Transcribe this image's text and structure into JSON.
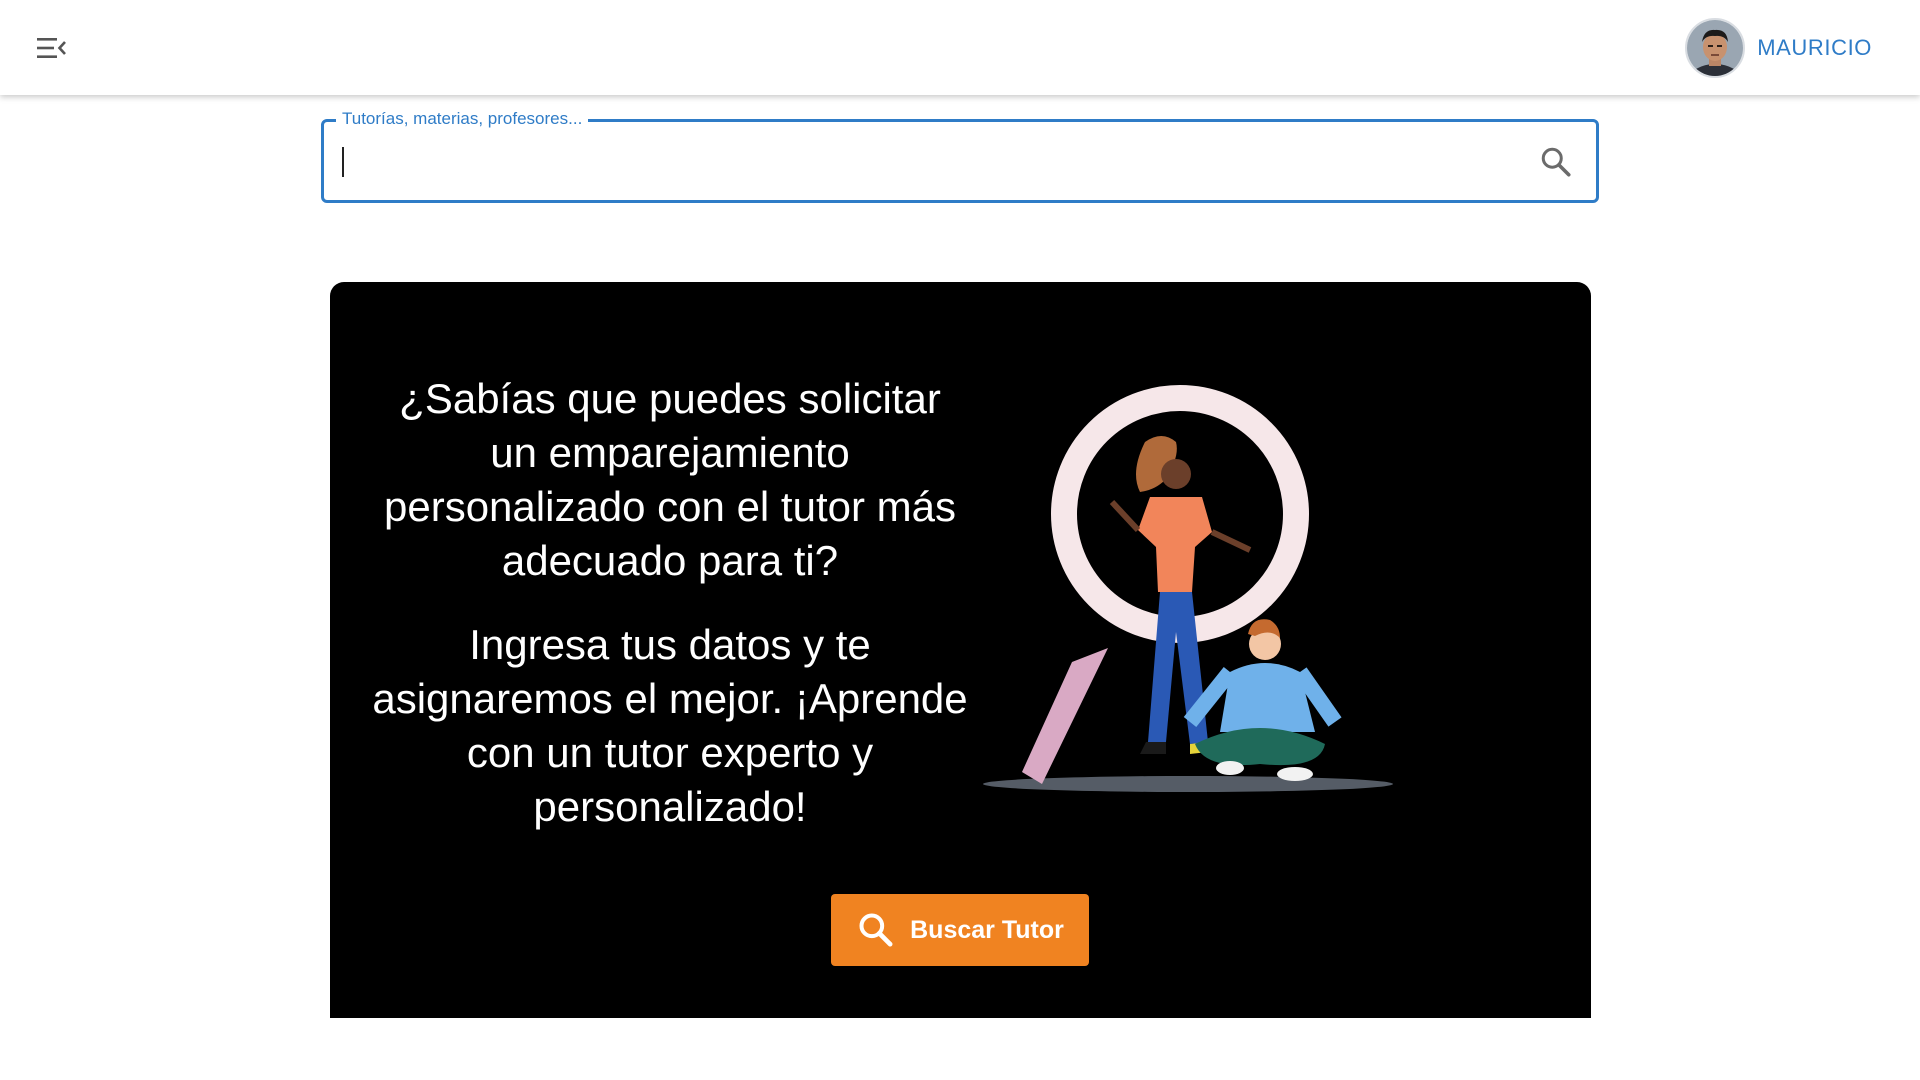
{
  "header": {
    "menu_icon": "menu-collapse-icon",
    "user": {
      "name": "MAURICIO",
      "avatar_icon": "avatar"
    }
  },
  "search": {
    "label": "Tutorías, materias, profesores...",
    "value": "",
    "icon": "search-icon"
  },
  "promo": {
    "question": "¿Sabías que puedes solicitar un emparejamiento personalizado con el tutor más adecuado para ti?",
    "body": "Ingresa tus datos y te asignaremos el mejor. ¡Aprende con un tutor experto y personalizado!",
    "cta_label": "Buscar Tutor",
    "cta_icon": "search-icon"
  },
  "colors": {
    "accent": "#2f7cc7",
    "banner_bg": "#000000",
    "cta_bg": "#f08321"
  }
}
